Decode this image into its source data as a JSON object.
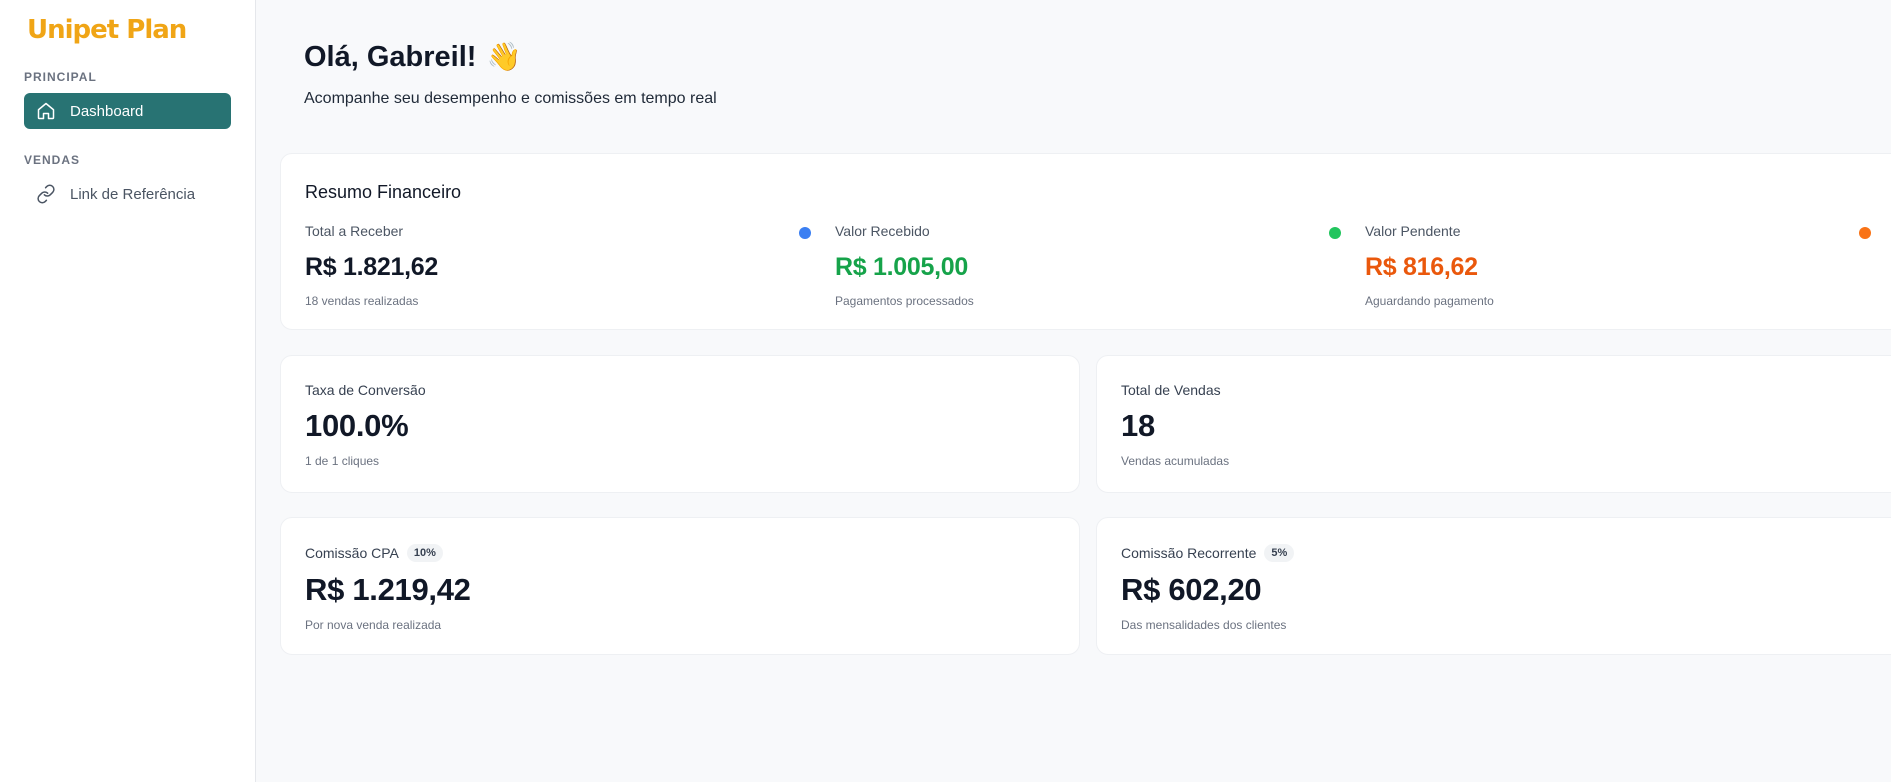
{
  "sidebar": {
    "logo": "Unipet Plan",
    "sections": [
      {
        "label": "PRINCIPAL",
        "items": [
          {
            "label": "Dashboard",
            "icon": "home-icon",
            "active": true
          }
        ]
      },
      {
        "label": "VENDAS",
        "items": [
          {
            "label": "Link de Referência",
            "icon": "link-icon",
            "active": false
          }
        ]
      }
    ]
  },
  "header": {
    "greeting": "Olá, Gabreil!",
    "wave_emoji": "👋",
    "subtitle": "Acompanhe seu desempenho e comissões em tempo real"
  },
  "summary": {
    "title": "Resumo Financeiro",
    "metrics": [
      {
        "label": "Total a Receber",
        "value": "R$ 1.821,62",
        "note": "18 vendas realizadas",
        "color": "#111827",
        "dot": "#3b7ff2"
      },
      {
        "label": "Valor Recebido",
        "value": "R$ 1.005,00",
        "note": "Pagamentos processados",
        "color": "#16a34a",
        "dot": "#22c55e"
      },
      {
        "label": "Valor Pendente",
        "value": "R$ 816,62",
        "note": "Aguardando pagamento",
        "color": "#ea580c",
        "dot": "#f97316"
      }
    ]
  },
  "stats": {
    "conversion": {
      "label": "Taxa de Conversão",
      "value": "100.0%",
      "note": "1 de 1 cliques"
    },
    "total_sales": {
      "label": "Total de Vendas",
      "value": "18",
      "note": "Vendas acumuladas"
    },
    "cpa": {
      "label": "Comissão CPA",
      "badge": "10%",
      "value": "R$ 1.219,42",
      "note": "Por nova venda realizada"
    },
    "recurring": {
      "label": "Comissão Recorrente",
      "badge": "5%",
      "value": "R$ 602,20",
      "note": "Das mensalidades dos clientes"
    }
  },
  "colors": {
    "accent": "#287373",
    "brand": "#f0a516"
  }
}
